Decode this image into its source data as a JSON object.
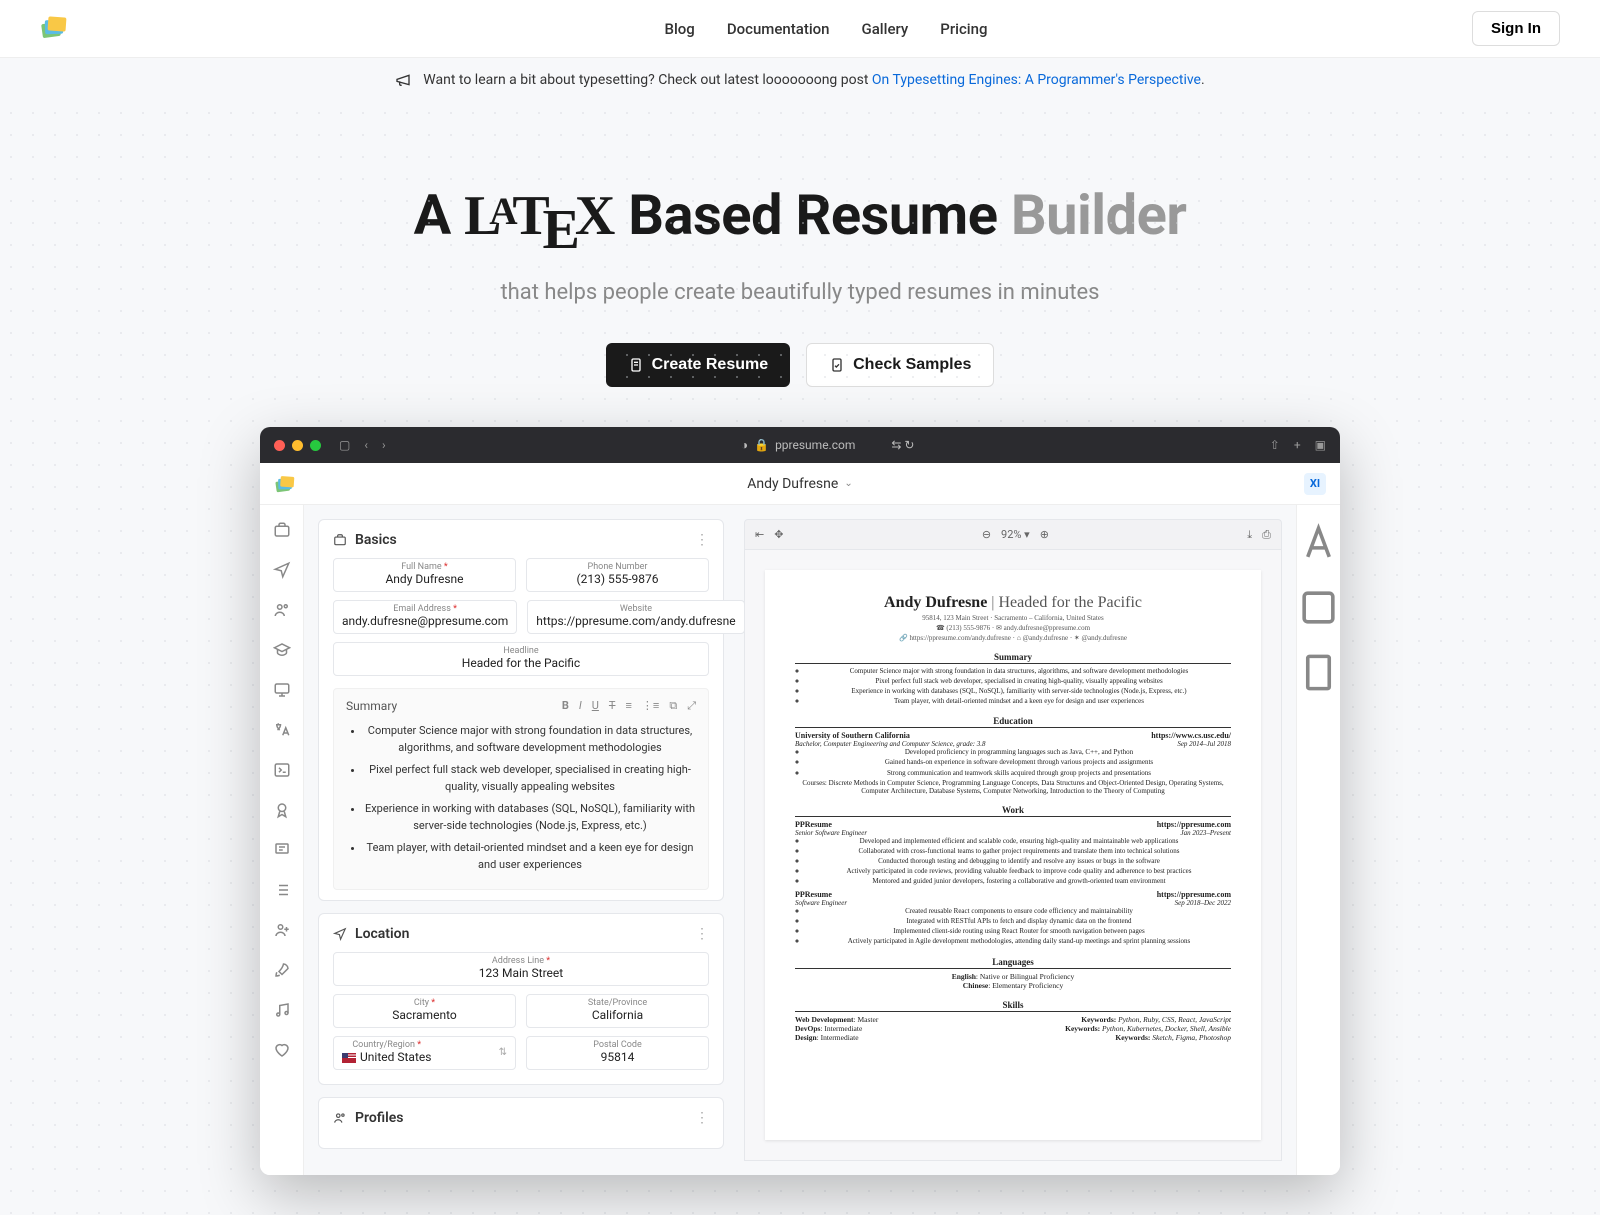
{
  "header": {
    "nav": [
      "Blog",
      "Documentation",
      "Gallery",
      "Pricing"
    ],
    "signin": "Sign In"
  },
  "announce": {
    "text": "Want to learn a bit about typesetting? Check out latest looooooong post ",
    "link": "On Typesetting Engines: A Programmer's Perspective",
    "dot": "."
  },
  "hero": {
    "h1_pre": "A ",
    "h1_mid": " Based Resume ",
    "h1_muted": "Builder",
    "subtitle": "that helps people create beautifully typed resumes in minutes",
    "btn_primary": "Create Resume",
    "btn_secondary": "Check Samples"
  },
  "browser": {
    "address": "ppresume.com"
  },
  "app": {
    "title": "Andy Dufresne",
    "badge": "XI"
  },
  "form": {
    "sections": {
      "basics": {
        "title": "Basics",
        "fields": {
          "full_name": {
            "label": "Full Name",
            "req": true,
            "value": "Andy Dufresne"
          },
          "phone": {
            "label": "Phone Number",
            "req": false,
            "value": "(213) 555-9876"
          },
          "email": {
            "label": "Email Address",
            "req": true,
            "value": "andy.dufresne@ppresume.com"
          },
          "website": {
            "label": "Website",
            "req": false,
            "value": "https://ppresume.com/andy.dufresne"
          },
          "headline": {
            "label": "Headline",
            "req": false,
            "value": "Headed for the Pacific"
          }
        },
        "summary_label": "Summary",
        "summary": [
          "Computer Science major with strong foundation in data structures, algorithms, and software development methodologies",
          "Pixel perfect full stack web developer, specialised in creating high-quality, visually appealing websites",
          "Experience in working with databases (SQL, NoSQL), familiarity with server-side technologies (Node.js, Express, etc.)",
          "Team player, with detail-oriented mindset and a keen eye for design and user experiences"
        ]
      },
      "location": {
        "title": "Location",
        "fields": {
          "address": {
            "label": "Address Line",
            "req": true,
            "value": "123 Main Street"
          },
          "city": {
            "label": "City",
            "req": true,
            "value": "Sacramento"
          },
          "state": {
            "label": "State/Province",
            "req": false,
            "value": "California"
          },
          "country": {
            "label": "Country/Region",
            "req": true,
            "value": "United States"
          },
          "postal": {
            "label": "Postal Code",
            "req": false,
            "value": "95814"
          }
        }
      },
      "profiles": {
        "title": "Profiles"
      }
    }
  },
  "preview": {
    "zoom": "92%",
    "resume": {
      "name": "Andy Dufresne",
      "tagline": "Headed for the Pacific",
      "addr": "95814, 123 Main Street · Sacramento – California, United States",
      "contact_line": "☎ (213) 555-9876  ·  ✉ andy.dufresne@ppresume.com",
      "links_line": "🔗 https://ppresume.com/andy.dufresne  ·  ⌂ @andy.dufresne  ·  ✶ @andy.dufresne",
      "sections": {
        "summary": {
          "title": "Summary",
          "bullets": [
            "Computer Science major with strong foundation in data structures, algorithms, and software development methodologies",
            "Pixel perfect full stack web developer, specialised in creating high-quality, visually appealing websites",
            "Experience in working with databases (SQL, NoSQL), familiarity with server-side technologies (Node.js, Express, etc.)",
            "Team player, with detail-oriented mindset and a keen eye for design and user experiences"
          ]
        },
        "education": {
          "title": "Education",
          "school": "University of Southern California",
          "dates": "Sep 2014–Jul 2018",
          "degree": "Bachelor, Computer Engineering and Computer Science, grade: 3.8",
          "url": "https://www.cs.usc.edu/",
          "bullets": [
            "Developed proficiency in programming languages such as Java, C++, and Python",
            "Gained hands-on experience in software development through various projects and assignments",
            "Strong communication and teamwork skills acquired through group projects and presentations"
          ],
          "courses": "Courses: Discrete Methods in Computer Science, Programming Language Concepts, Data Structures and Object-Oriented Design, Operating Systems, Computer Architecture, Database Systems, Computer Networking, Introduction to the Theory of Computing"
        },
        "work": {
          "title": "Work",
          "jobs": [
            {
              "company": "PPResume",
              "url": "https://ppresume.com",
              "role": "Senior Software Engineer",
              "dates": "Jan 2023–Present",
              "bullets": [
                "Developed and implemented efficient and scalable code, ensuring high-quality and maintainable web applications",
                "Collaborated with cross-functional teams to gather project requirements and translate them into technical solutions",
                "Conducted thorough testing and debugging to identify and resolve any issues or bugs in the software",
                "Actively participated in code reviews, providing valuable feedback to improve code quality and adherence to best practices",
                "Mentored and guided junior developers, fostering a collaborative and growth-oriented team environment"
              ]
            },
            {
              "company": "PPResume",
              "url": "https://ppresume.com",
              "role": "Software Engineer",
              "dates": "Sep 2018–Dec 2022",
              "bullets": [
                "Created reusable React components to ensure code efficiency and maintainability",
                "Integrated with RESTful APIs to fetch and display dynamic data on the frontend",
                "Implemented client-side routing using React Router for smooth navigation between pages",
                "Actively participated in Agile development methodologies, attending daily stand-up meetings and sprint planning sessions"
              ]
            }
          ]
        },
        "languages": {
          "title": "Languages",
          "items": [
            {
              "name": "English",
              "level": "Native or Bilingual Proficiency"
            },
            {
              "name": "Chinese",
              "level": "Elementary Proficiency"
            }
          ]
        },
        "skills": {
          "title": "Skills",
          "items": [
            {
              "name": "Web Development",
              "level": "Master",
              "kw": "Python, Ruby, CSS, React, JavaScript"
            },
            {
              "name": "DevOps",
              "level": "Intermediate",
              "kw": "Python, Kubernetes, Docker, Shell, Ansible"
            },
            {
              "name": "Design",
              "level": "Intermediate",
              "kw": "Sketch, Figma, Photoshop"
            }
          ]
        }
      }
    }
  }
}
